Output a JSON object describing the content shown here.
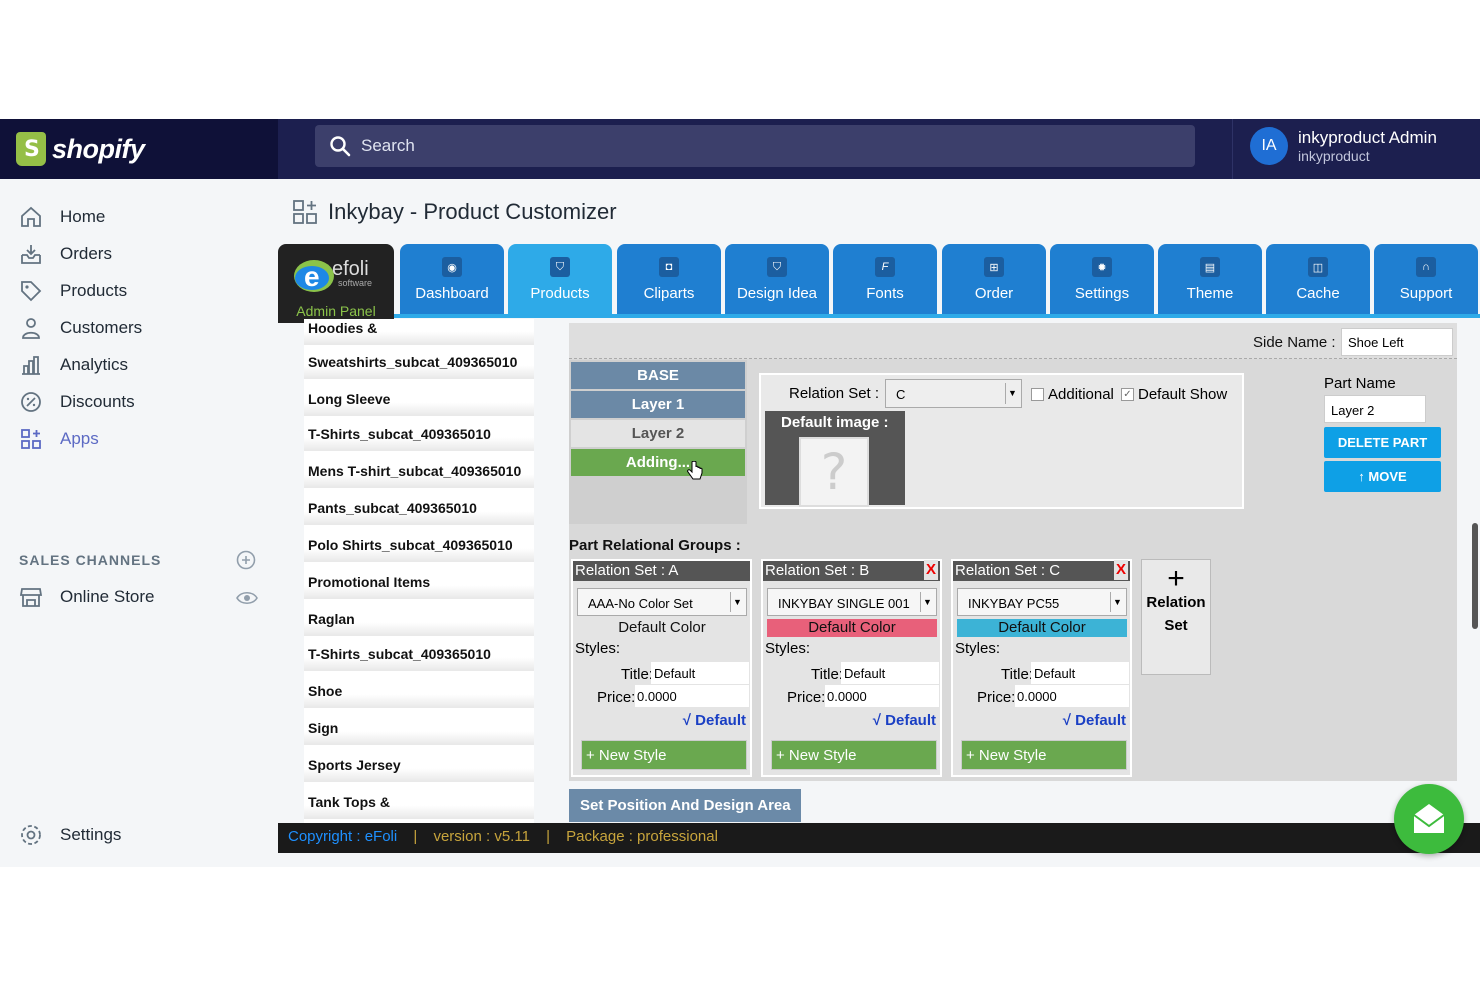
{
  "topbar": {
    "brand": "shopify",
    "search_placeholder": "Search",
    "user_initials": "IA",
    "user_name": "inkyproduct Admin",
    "user_store": "inkyproduct"
  },
  "sidebar": {
    "items": [
      {
        "label": "Home",
        "icon": "home-icon"
      },
      {
        "label": "Orders",
        "icon": "orders-icon"
      },
      {
        "label": "Products",
        "icon": "tag-icon"
      },
      {
        "label": "Customers",
        "icon": "person-icon"
      },
      {
        "label": "Analytics",
        "icon": "bar-chart-icon"
      },
      {
        "label": "Discounts",
        "icon": "discount-icon"
      },
      {
        "label": "Apps",
        "icon": "apps-icon",
        "active": true
      }
    ],
    "sales_channels_title": "SALES CHANNELS",
    "online_store": "Online Store",
    "settings": "Settings"
  },
  "page": {
    "title": "Inkybay - Product Customizer"
  },
  "app": {
    "panel_label": "Admin Panel",
    "logo_text": "efoli",
    "logo_sub": "software",
    "tabs": [
      {
        "label": "Dashboard",
        "icon": "dashboard-icon"
      },
      {
        "label": "Products",
        "icon": "shirt-icon",
        "selected": true
      },
      {
        "label": "Cliparts",
        "icon": "camera-icon"
      },
      {
        "label": "Design Idea",
        "icon": "shirt-icon"
      },
      {
        "label": "Fonts",
        "icon": "font-icon"
      },
      {
        "label": "Order",
        "icon": "cart-icon"
      },
      {
        "label": "Settings",
        "icon": "gear-icon"
      },
      {
        "label": "Theme",
        "icon": "theme-icon"
      },
      {
        "label": "Cache",
        "icon": "database-icon"
      },
      {
        "label": "Support",
        "icon": "headset-icon"
      }
    ],
    "categories": [
      "Hoodies &",
      "Sweatshirts_subcat_409365010",
      "Long Sleeve",
      "T-Shirts_subcat_409365010",
      "Mens T-shirt_subcat_409365010",
      "Pants_subcat_409365010",
      "Polo Shirts_subcat_409365010",
      "Promotional Items",
      "Raglan",
      "T-Shirts_subcat_409365010",
      "Shoe",
      "Sign",
      "Sports Jersey",
      "Tank Tops &"
    ],
    "editor": {
      "side_name_label": "Side Name :",
      "side_name_value": "Shoe Left",
      "layers": [
        "BASE",
        "Layer 1",
        "Layer 2",
        "Adding..."
      ],
      "relation_set_label": "Relation Set :",
      "relation_set_value": "C",
      "additional_label": "Additional",
      "default_show_label": "Default Show",
      "default_image_label": "Default image :",
      "part_name_label": "Part Name",
      "part_name_value": "Layer 2",
      "delete_part": "DELETE PART",
      "move": "↑ MOVE",
      "groups_title": "Part Relational Groups :",
      "groups": [
        {
          "head": "Relation Set : A",
          "select": "AAA-No Color Set",
          "color_label": "Default Color",
          "color": "#e4e4e4",
          "styles": "Styles:",
          "title_label": "Title:",
          "title": "Default",
          "price_label": "Price:",
          "price": "0.0000",
          "default": "√ Default",
          "new_style": "+ New Style",
          "removable": false
        },
        {
          "head": "Relation Set : B",
          "select": "INKYBAY SINGLE 001",
          "color_label": "Default Color",
          "color": "#e8607a",
          "styles": "Styles:",
          "title_label": "Title:",
          "title": "Default",
          "price_label": "Price:",
          "price": "0.0000",
          "default": "√ Default",
          "new_style": "+ New Style",
          "removable": true
        },
        {
          "head": "Relation Set : C",
          "select": "INKYBAY PC55",
          "color_label": "Default Color",
          "color": "#3cb3d6",
          "styles": "Styles:",
          "title_label": "Title:",
          "title": "Default",
          "price_label": "Price:",
          "price": "0.0000",
          "default": "√ Default",
          "new_style": "+ New Style",
          "removable": true
        }
      ],
      "remove_mark": "X",
      "add_relation_line1": "Relation",
      "add_relation_line2": "Set",
      "set_position": "Set Position And Design Area"
    },
    "footer": {
      "copyright": "Copyright : eFoli",
      "sep": "|",
      "version": "version : v5.11",
      "package": "Package : professional"
    }
  },
  "colors": {
    "topbar": "#1c1f4f",
    "tab": "#1f7fd1",
    "tab_selected": "#2eaae8",
    "green": "#6aa84f"
  }
}
